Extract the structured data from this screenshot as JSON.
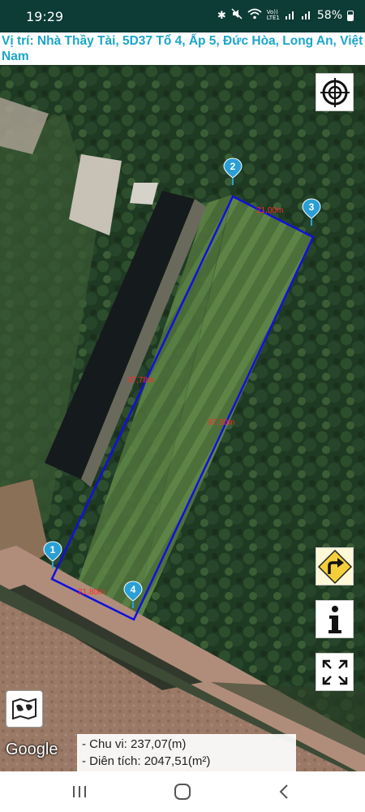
{
  "status_bar": {
    "time": "19:29",
    "battery": "58%",
    "icons": [
      "bluetooth-icon",
      "mute-icon",
      "wifi-icon",
      "volte-icon",
      "signal-icon",
      "signal-icon",
      "battery-icon"
    ],
    "volte_label": "Vo))\nLTE1"
  },
  "location": {
    "text": " Vị trí: Nhà Thầy Tài, 5D37 Tổ 4, Ấp 5, Đức Hòa, Long An, Việt Nam"
  },
  "map": {
    "markers": [
      "1",
      "2",
      "3",
      "4"
    ],
    "edge_labels": {
      "top": "21,00m",
      "left": "97,78m",
      "right": "97,30m",
      "bottom": "21,80m"
    },
    "polygon_color": "#1010e0",
    "marker_color": "#2a9fd6",
    "label_color": "#ff2a2a",
    "google_logo": "Google"
  },
  "stats": {
    "perimeter": "- Chu vi: 237,07(m)",
    "area": "- Diên tích: 2047,51(m²)"
  },
  "buttons": {
    "locate": "crosshair-icon",
    "directions": "turn-right-icon",
    "info": "info-icon",
    "fullscreen": "expand-icon",
    "map_type": "map-icon"
  },
  "nav": [
    "recent-apps-icon",
    "home-icon",
    "back-icon"
  ]
}
